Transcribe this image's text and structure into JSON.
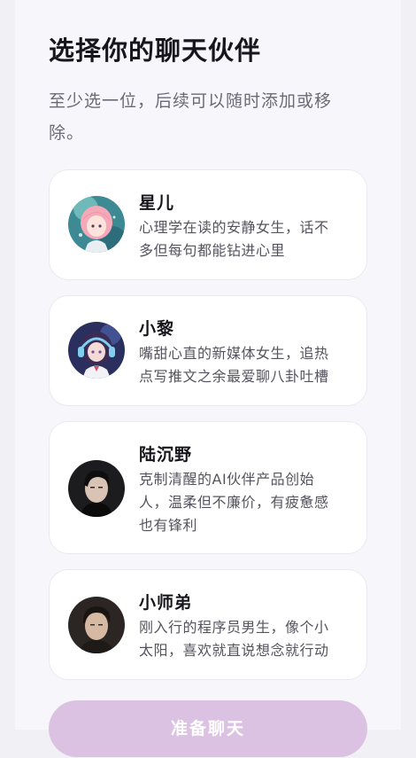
{
  "header": {
    "title": "选择你的聊天伙伴",
    "subtitle": "至少选一位，后续可以随时添加或移除。"
  },
  "companions": [
    {
      "name": "星儿",
      "description": "心理学在读的安静女生，话不多但每句都能钻进心里",
      "avatar": "anime-girl-pink-hair-avatar"
    },
    {
      "name": "小黎",
      "description": "嘴甜心直的新媒体女生，追热点写推文之余最爱聊八卦吐槽",
      "avatar": "anime-girl-headphones-avatar"
    },
    {
      "name": "陆沉野",
      "description": "克制清醒的AI伙伴产品创始人，温柔但不廉价，有疲惫感也有锋利",
      "avatar": "man-portrait-avatar"
    },
    {
      "name": "小师弟",
      "description": "刚入行的程序员男生，像个小太阳，喜欢就直说想念就行动",
      "avatar": "young-man-portrait-avatar"
    }
  ],
  "footer": {
    "button_label": "准备聊天"
  },
  "colors": {
    "background": "#f7f6fa",
    "card": "#ffffff",
    "button_disabled": "#dcc2e2"
  }
}
